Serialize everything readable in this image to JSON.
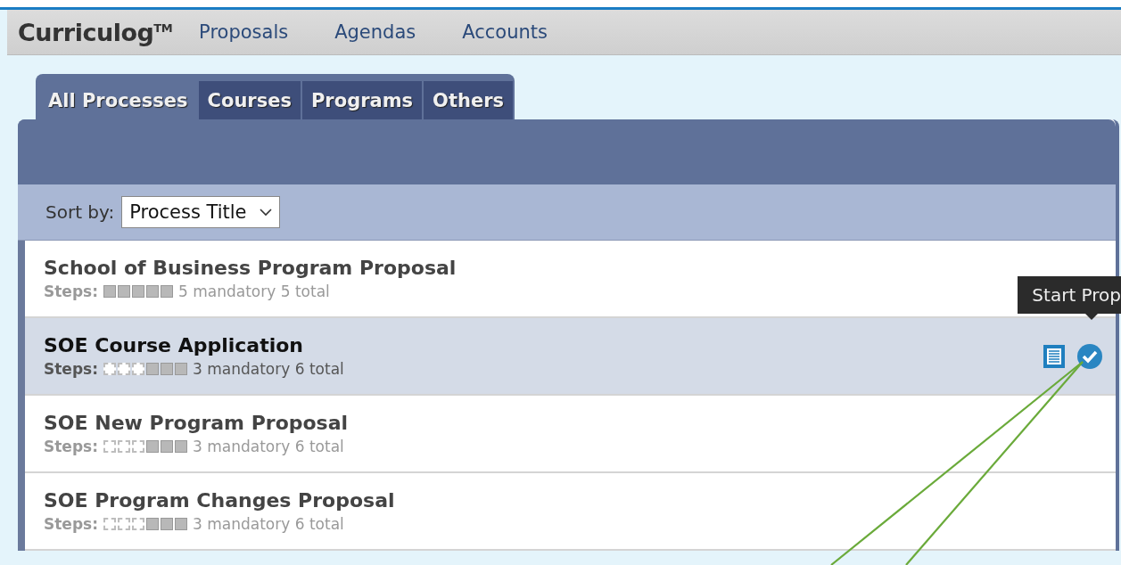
{
  "header": {
    "logo": "Curriculog",
    "trademark": "TM",
    "nav": [
      "Proposals",
      "Agendas",
      "Accounts"
    ]
  },
  "tabs": [
    {
      "label": "All Processes",
      "selected": true
    },
    {
      "label": "Courses",
      "selected": false
    },
    {
      "label": "Programs",
      "selected": false
    },
    {
      "label": "Others",
      "selected": false
    }
  ],
  "sort": {
    "label": "Sort by:",
    "value": "Process Title"
  },
  "processes": [
    {
      "title": "School of Business Program Proposal",
      "selected": false,
      "steps_label": "Steps:",
      "steps": [
        true,
        true,
        true,
        true,
        true
      ],
      "summary": "5 mandatory 5 total"
    },
    {
      "title": "SOE Course Application",
      "selected": true,
      "steps_label": "Steps:",
      "steps": [
        false,
        false,
        false,
        true,
        true,
        true
      ],
      "summary": "3 mandatory 6 total"
    },
    {
      "title": "SOE New Program Proposal",
      "selected": false,
      "steps_label": "Steps:",
      "steps": [
        false,
        false,
        false,
        true,
        true,
        true
      ],
      "summary": "3 mandatory 6 total"
    },
    {
      "title": "SOE Program Changes Proposal",
      "selected": false,
      "steps_label": "Steps:",
      "steps": [
        false,
        false,
        false,
        true,
        true,
        true
      ],
      "summary": "3 mandatory 6 total"
    }
  ],
  "tooltip": "Start Prop"
}
